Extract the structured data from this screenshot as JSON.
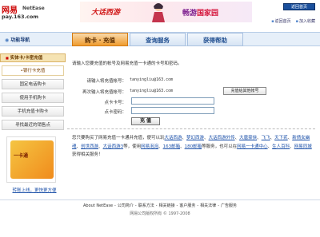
{
  "header": {
    "logo_cn": "网易",
    "logo_en": "NetEase",
    "logo_url": "pay.163.com",
    "banner_left": "大话西游",
    "banner_right_prefix": "畅游",
    "banner_right_brand": "国家园",
    "return_button": "返回首页",
    "links": [
      "返回首页",
      "加入收藏"
    ]
  },
  "nav": {
    "func_nav": "功能导航",
    "tabs": [
      {
        "label": "购卡 · 充值",
        "active": true
      },
      {
        "label": "查询服务",
        "active": false
      },
      {
        "label": "获得帮助",
        "active": false
      }
    ]
  },
  "sidebar": {
    "section": "实体卡/卡密充值",
    "items": [
      "•银行卡充值",
      "固定电话购卡",
      "使用手机购卡",
      "手机充值卡购卡",
      "寻找最近的销售点"
    ],
    "promo_card": "一卡通",
    "caption": "转账上线，更快更方便"
  },
  "form": {
    "prompt": "请输入您要充值的帐号及网易充值一卡通的卡号和密码。",
    "account_label": "请输入将充值帐号：",
    "account_value": "tanyingliu@163.com",
    "confirm_label": "再次输入将充值帐号：",
    "confirm_value": "tanyingliu@163.com",
    "other_button": "充值给其他帐号",
    "card_label": "点卡卡号：",
    "password_label": "点卡密码：",
    "submit_button": "充 值"
  },
  "info": {
    "text_before": "您只要购买了网易充值一卡通并充值，便可以玩",
    "games": [
      "大话西游",
      "梦幻西游",
      "大话西游外传",
      "大唐豪侠",
      "飞飞",
      "天下贰",
      "新倩女幽魂",
      "创世西游",
      "大话西游3"
    ],
    "text_mid": "等，使用",
    "services": [
      "网易泡泡",
      "163邮箱",
      "180邮箱"
    ],
    "text_after": "等服务，也可以在",
    "places": [
      "网易一卡通中心",
      "生人百科",
      "网易同城"
    ],
    "text_end": "获得相关服务！"
  },
  "footer": {
    "links": [
      "About NetEase",
      "公司简介",
      "联系方法",
      "相关链接",
      "客户服务",
      "相关法律",
      "广告服务"
    ],
    "copyright": "网易公司版权所有 © 1997-2008"
  }
}
